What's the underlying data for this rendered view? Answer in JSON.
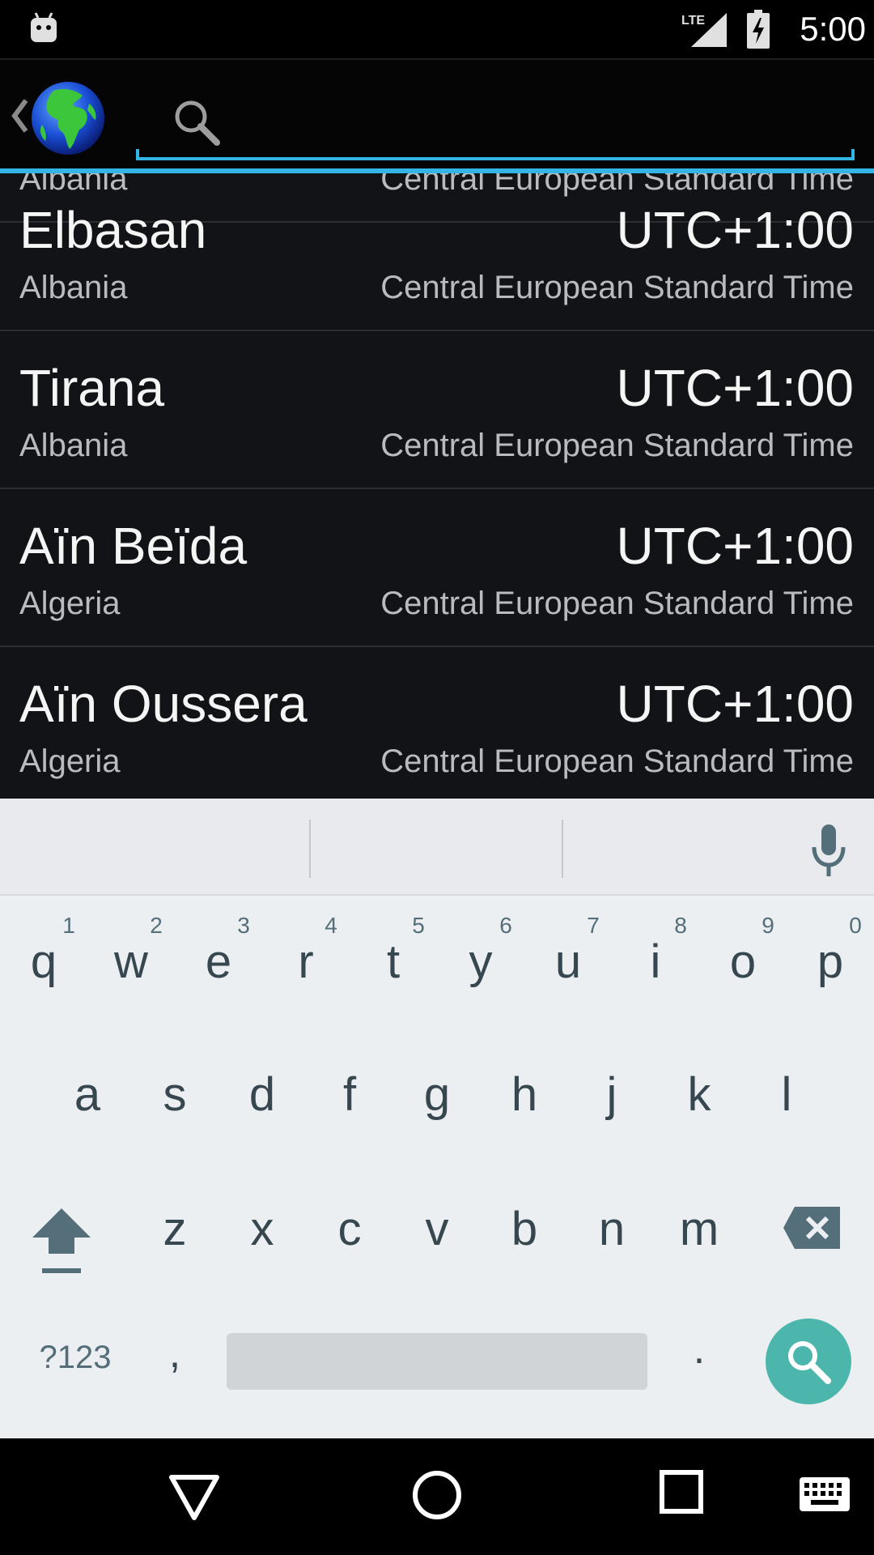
{
  "status_bar": {
    "time": "5:00",
    "network_label": "LTE",
    "icons": [
      "android-notification-icon",
      "lte-signal-icon",
      "battery-charging-icon"
    ]
  },
  "action_bar": {
    "app_icon": "globe-icon",
    "search_placeholder": "",
    "search_value": "",
    "accent_color": "#33b5e5"
  },
  "list": {
    "rows": [
      {
        "city": "",
        "country": "Albania",
        "offset": "",
        "zone": "Central European Standard Time"
      },
      {
        "city": "Elbasan",
        "country": "Albania",
        "offset": "UTC+1:00",
        "zone": "Central European Standard Time"
      },
      {
        "city": "Tirana",
        "country": "Albania",
        "offset": "UTC+1:00",
        "zone": "Central European Standard Time"
      },
      {
        "city": "Aïn Beïda",
        "country": "Algeria",
        "offset": "UTC+1:00",
        "zone": "Central European Standard Time"
      },
      {
        "city": "Aïn Oussera",
        "country": "Algeria",
        "offset": "UTC+1:00",
        "zone": "Central European Standard Time"
      }
    ]
  },
  "keyboard": {
    "row1": [
      "q",
      "w",
      "e",
      "r",
      "t",
      "y",
      "u",
      "i",
      "o",
      "p"
    ],
    "row1_hints": [
      "1",
      "2",
      "3",
      "4",
      "5",
      "6",
      "7",
      "8",
      "9",
      "0"
    ],
    "row2": [
      "a",
      "s",
      "d",
      "f",
      "g",
      "h",
      "j",
      "k",
      "l"
    ],
    "row3": [
      "z",
      "x",
      "c",
      "v",
      "b",
      "n",
      "m"
    ],
    "symbols_label": "?123",
    "comma": ",",
    "period": ".",
    "action_color": "#4db6ac"
  },
  "nav_bar": {
    "icons": [
      "back-icon",
      "home-icon",
      "recents-icon",
      "keyboard-switch-icon"
    ]
  }
}
